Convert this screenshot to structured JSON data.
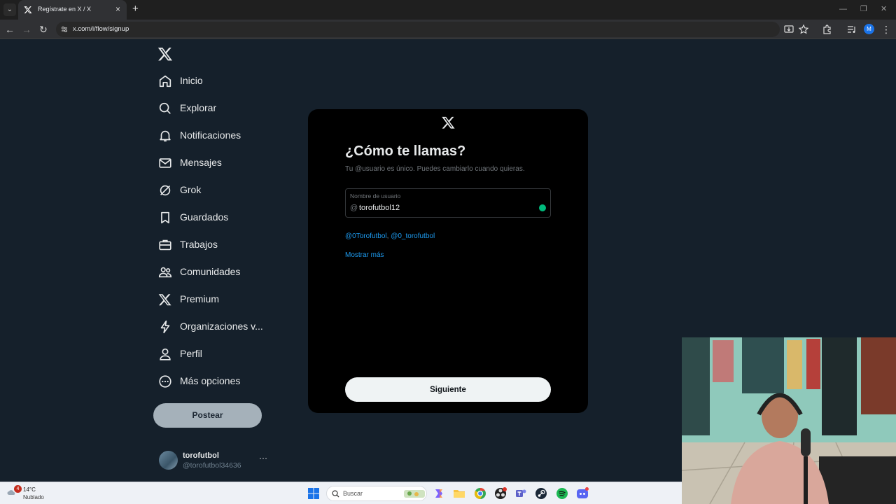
{
  "browser": {
    "tab_title": "Regístrate en X / X",
    "url": "x.com/i/flow/signup"
  },
  "sidebar": {
    "items": [
      {
        "label": "Inicio",
        "icon": "home-icon"
      },
      {
        "label": "Explorar",
        "icon": "search-icon"
      },
      {
        "label": "Notificaciones",
        "icon": "bell-icon"
      },
      {
        "label": "Mensajes",
        "icon": "envelope-icon"
      },
      {
        "label": "Grok",
        "icon": "grok-icon"
      },
      {
        "label": "Guardados",
        "icon": "bookmark-icon"
      },
      {
        "label": "Trabajos",
        "icon": "briefcase-icon"
      },
      {
        "label": "Comunidades",
        "icon": "people-icon"
      },
      {
        "label": "Premium",
        "icon": "x-icon"
      },
      {
        "label": "Organizaciones v...",
        "icon": "lightning-icon"
      },
      {
        "label": "Perfil",
        "icon": "person-icon"
      },
      {
        "label": "Más opciones",
        "icon": "more-circle-icon"
      }
    ],
    "post_label": "Postear",
    "account": {
      "name": "torofutbol",
      "handle": "@torofutbol34636",
      "more": "···"
    }
  },
  "modal": {
    "title": "¿Cómo te llamas?",
    "subtitle": "Tu @usuario es único. Puedes cambiarlo cuando quieras.",
    "field_label": "Nombre de usuario",
    "field_prefix": "@",
    "field_value": "torofutbol12",
    "suggestions": [
      "@0Torofutbol",
      "@0_torofutbol"
    ],
    "suggestion_separator": ",",
    "show_more": "Mostrar más",
    "next_label": "Siguiente"
  },
  "taskbar": {
    "weather_badge": "4",
    "weather_temp": "14°C",
    "weather_desc": "Nublado",
    "search_placeholder": "Buscar"
  },
  "profile_initial": "M",
  "colors": {
    "page_bg": "#15202b",
    "modal_bg": "#000000",
    "accent": "#1d9bf0",
    "success": "#00ba7c"
  }
}
